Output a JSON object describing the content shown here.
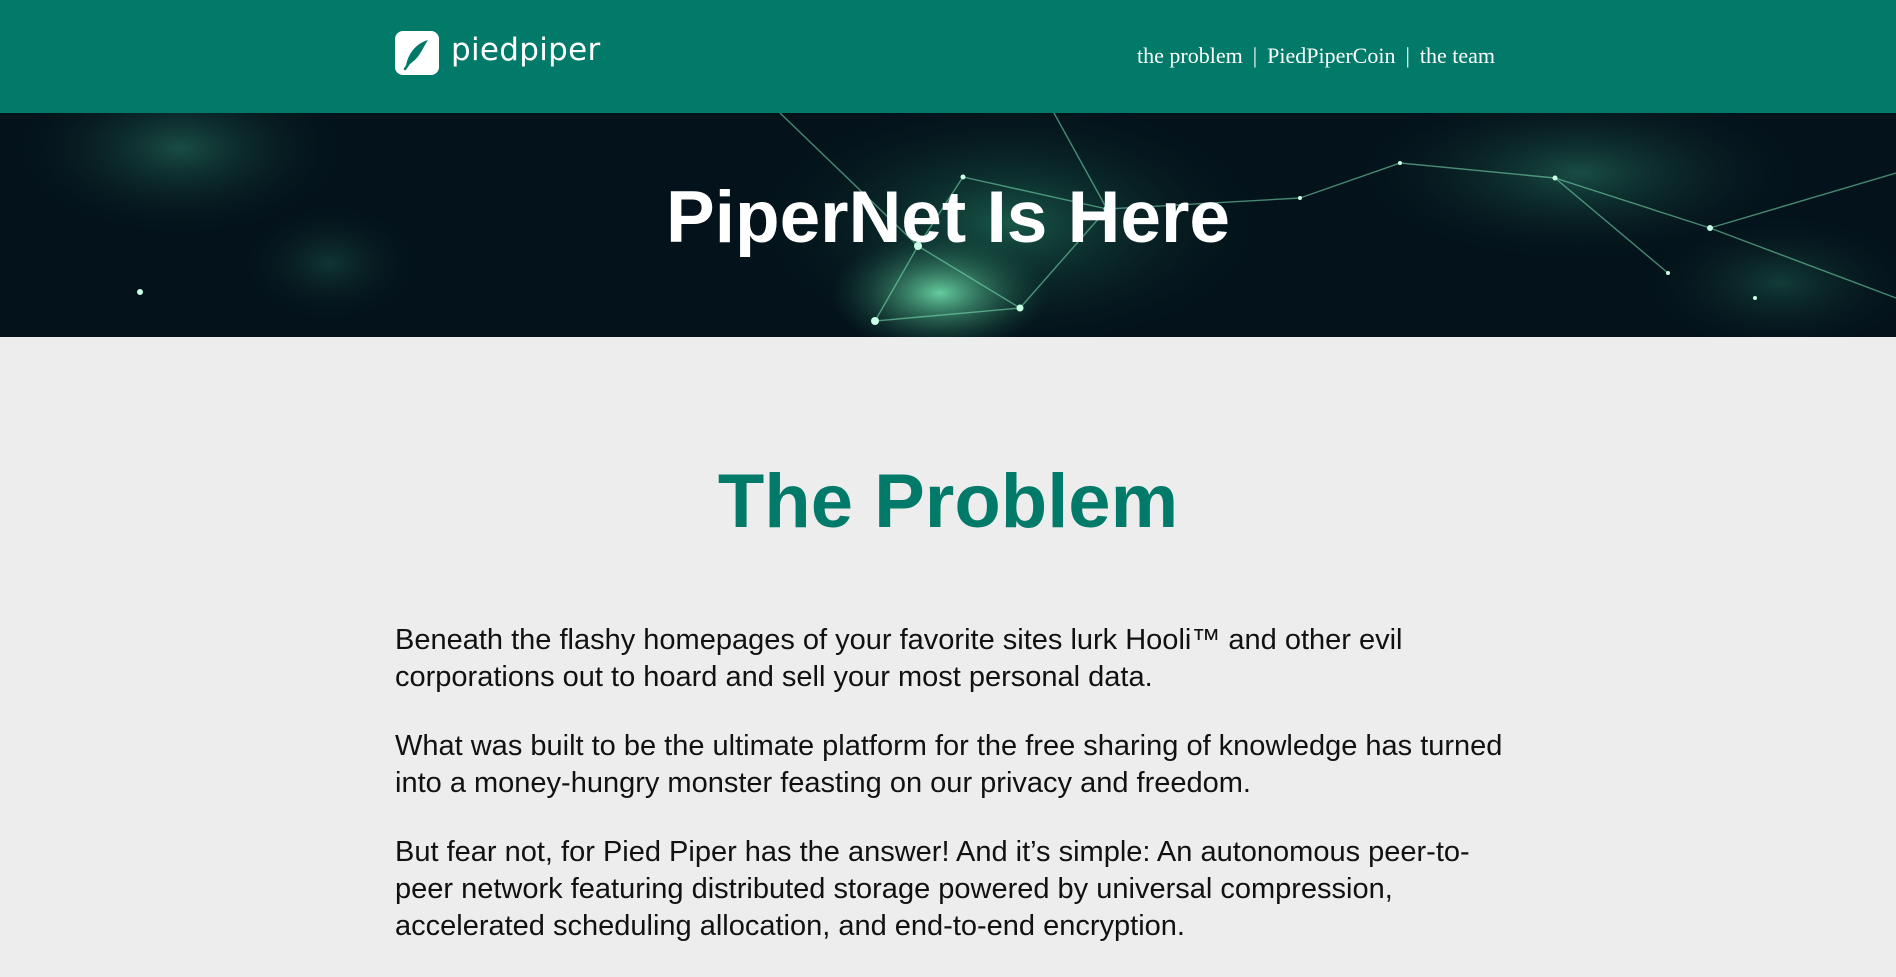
{
  "header": {
    "logo_text": "piedpiper",
    "nav": {
      "problem": "the problem",
      "coin": "PiedPiperCoin",
      "team": "the team",
      "separator": "|"
    }
  },
  "hero": {
    "title": "PiperNet Is Here"
  },
  "problem": {
    "title": "The Problem",
    "paragraphs": [
      "Beneath the flashy homepages of your favorite sites lurk Hooli™ and other evil corporations out to hoard and sell your most personal data.",
      "What was built to be the ultimate platform for the free sharing of knowledge has turned into a money-hungry monster feasting on our privacy and freedom.",
      "But fear not, for Pied Piper has the answer! And it’s simple: An autonomous peer-to-peer network featuring distributed storage powered by universal compression, accelerated scheduling allocation, and end-to-end encryption."
    ]
  },
  "colors": {
    "brand": "#027a6a",
    "page_bg": "#ededed",
    "hero_bg": "#04131b"
  }
}
